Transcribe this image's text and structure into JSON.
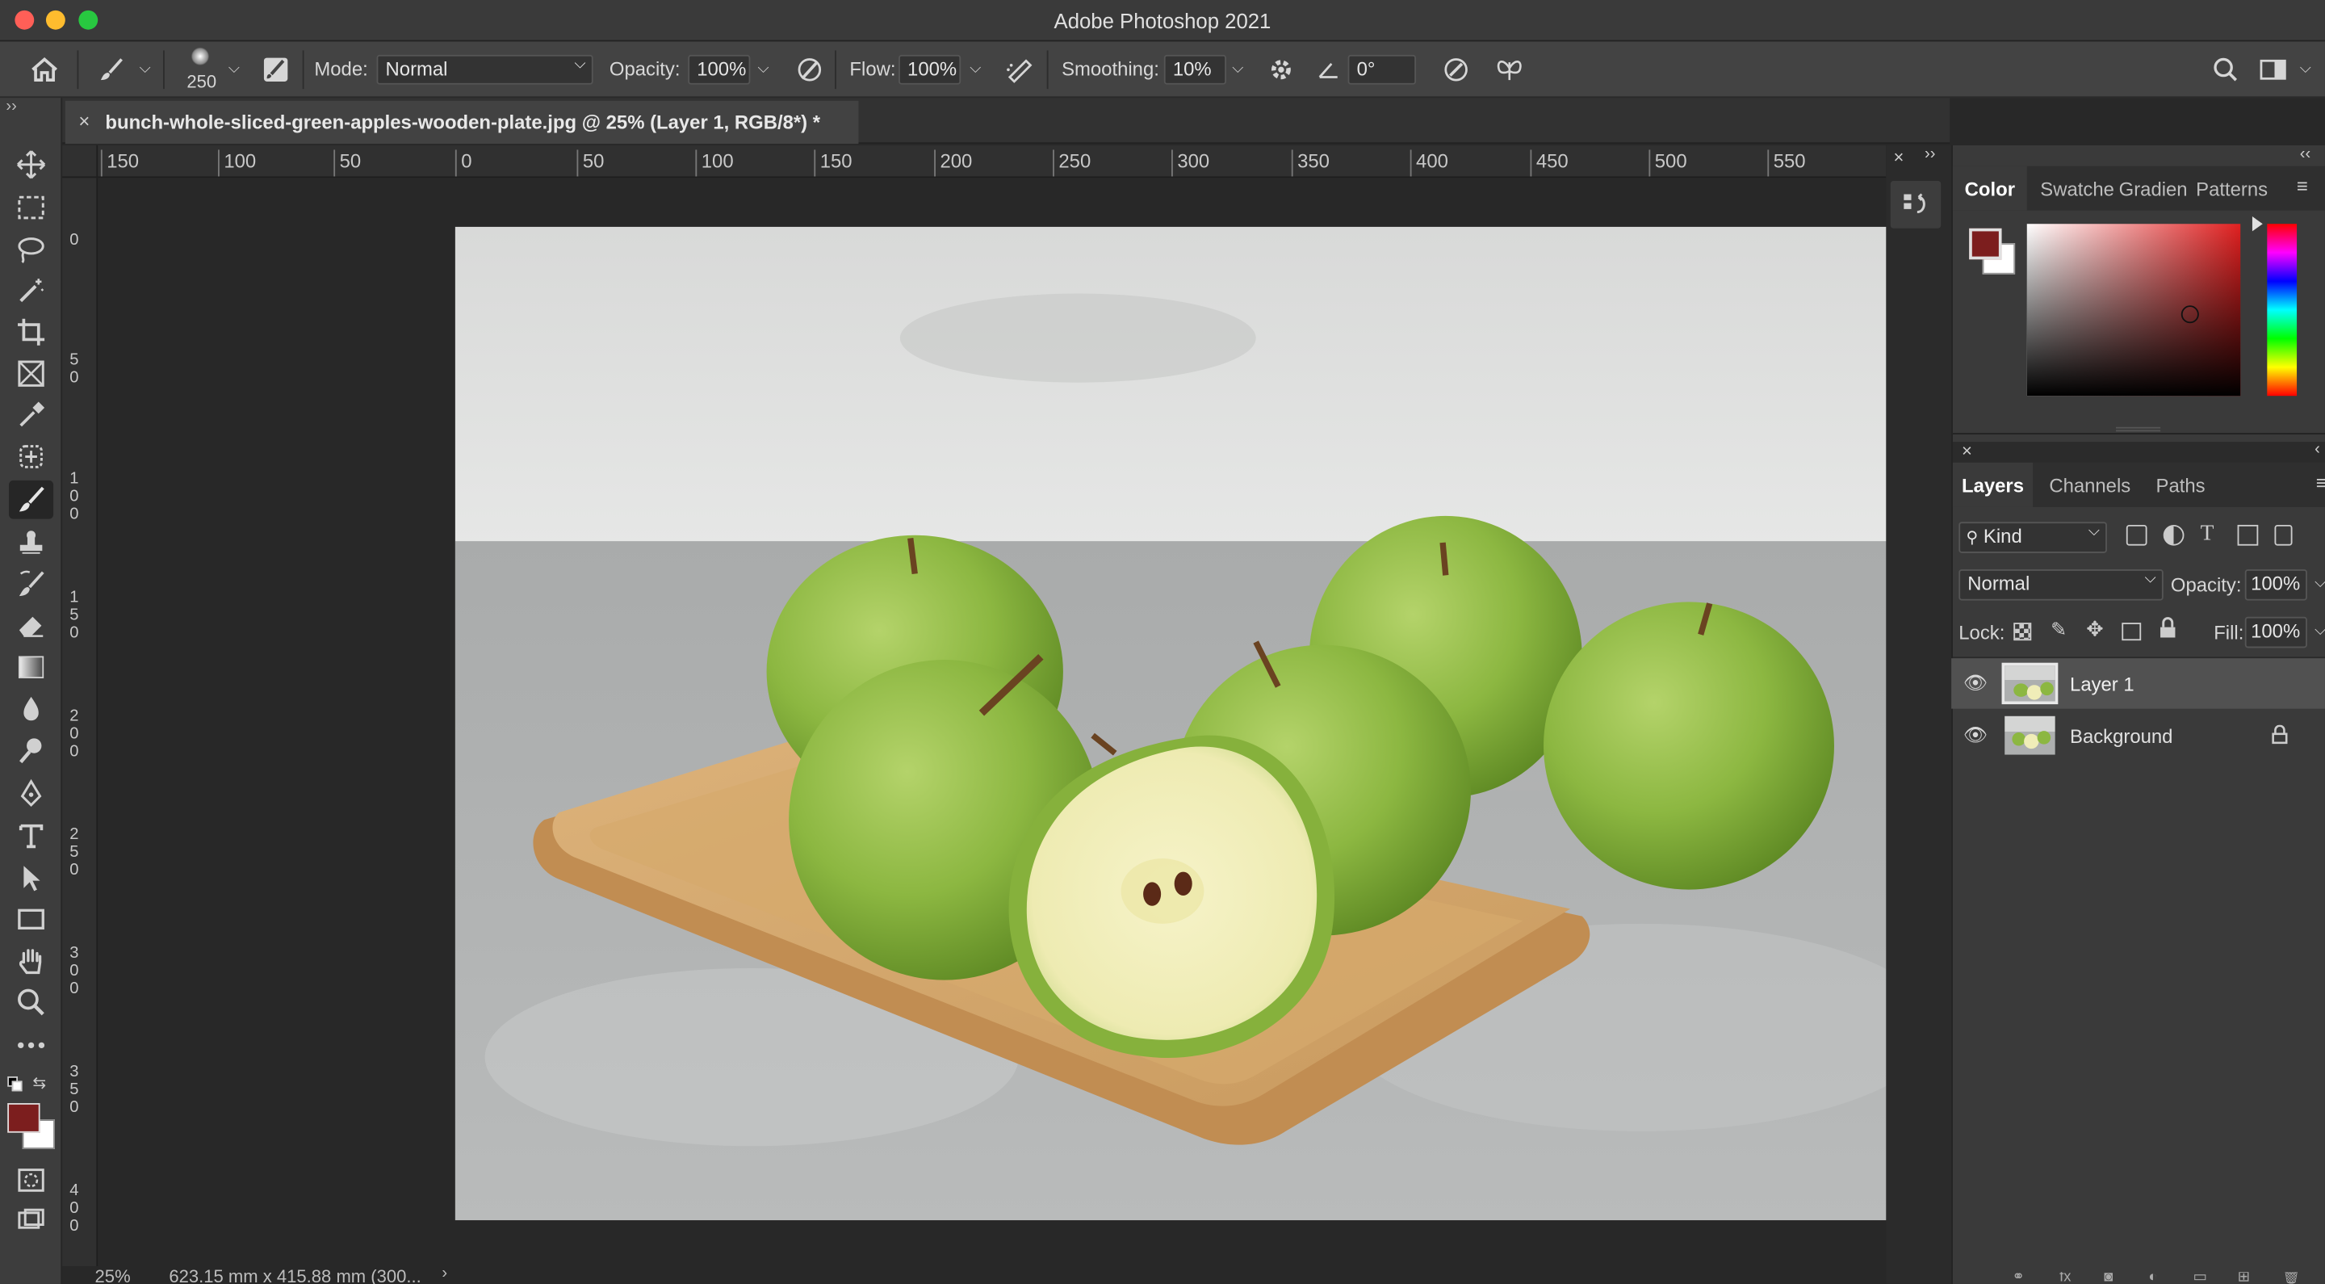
{
  "window": {
    "title": "Adobe Photoshop 2021"
  },
  "options_bar": {
    "brush_size": "250",
    "mode_label": "Mode:",
    "mode_value": "Normal",
    "opacity_label": "Opacity:",
    "opacity_value": "100%",
    "flow_label": "Flow:",
    "flow_value": "100%",
    "smoothing_label": "Smoothing:",
    "smoothing_value": "10%",
    "angle_value": "0°"
  },
  "document": {
    "tab_title": "bunch-whole-sliced-green-apples-wooden-plate.jpg @ 25% (Layer 1, RGB/8*) *",
    "zoom": "25%",
    "dimensions": "623.15 mm x 415.88 mm (300..."
  },
  "rulers": {
    "horizontal": [
      "150",
      "100",
      "50",
      "0",
      "50",
      "100",
      "150",
      "200",
      "250",
      "300",
      "350",
      "400",
      "450",
      "500",
      "550"
    ],
    "vertical": [
      [
        "0"
      ],
      [
        "5",
        "0"
      ],
      [
        "1",
        "0",
        "0"
      ],
      [
        "1",
        "5",
        "0"
      ],
      [
        "2",
        "0",
        "0"
      ],
      [
        "2",
        "5",
        "0"
      ],
      [
        "3",
        "0",
        "0"
      ],
      [
        "3",
        "5",
        "0"
      ],
      [
        "4",
        "0",
        "0"
      ]
    ]
  },
  "color_panel": {
    "tabs": [
      "Color",
      "Swatche",
      "Gradien",
      "Patterns"
    ],
    "foreground": "#7c1e1e",
    "background": "#ffffff"
  },
  "layers_panel": {
    "tabs": [
      "Layers",
      "Channels",
      "Paths"
    ],
    "filter_kind": "Kind",
    "blend_mode": "Normal",
    "opacity_label": "Opacity:",
    "opacity_value": "100%",
    "lock_label": "Lock:",
    "fill_label": "Fill:",
    "fill_value": "100%",
    "layers": [
      {
        "name": "Layer 1",
        "selected": true
      },
      {
        "name": "Background",
        "locked": true
      }
    ]
  },
  "colors": {
    "accent_fg": "#7c1e1e",
    "ui_dark": "#323232",
    "ui_mid": "#434343"
  }
}
